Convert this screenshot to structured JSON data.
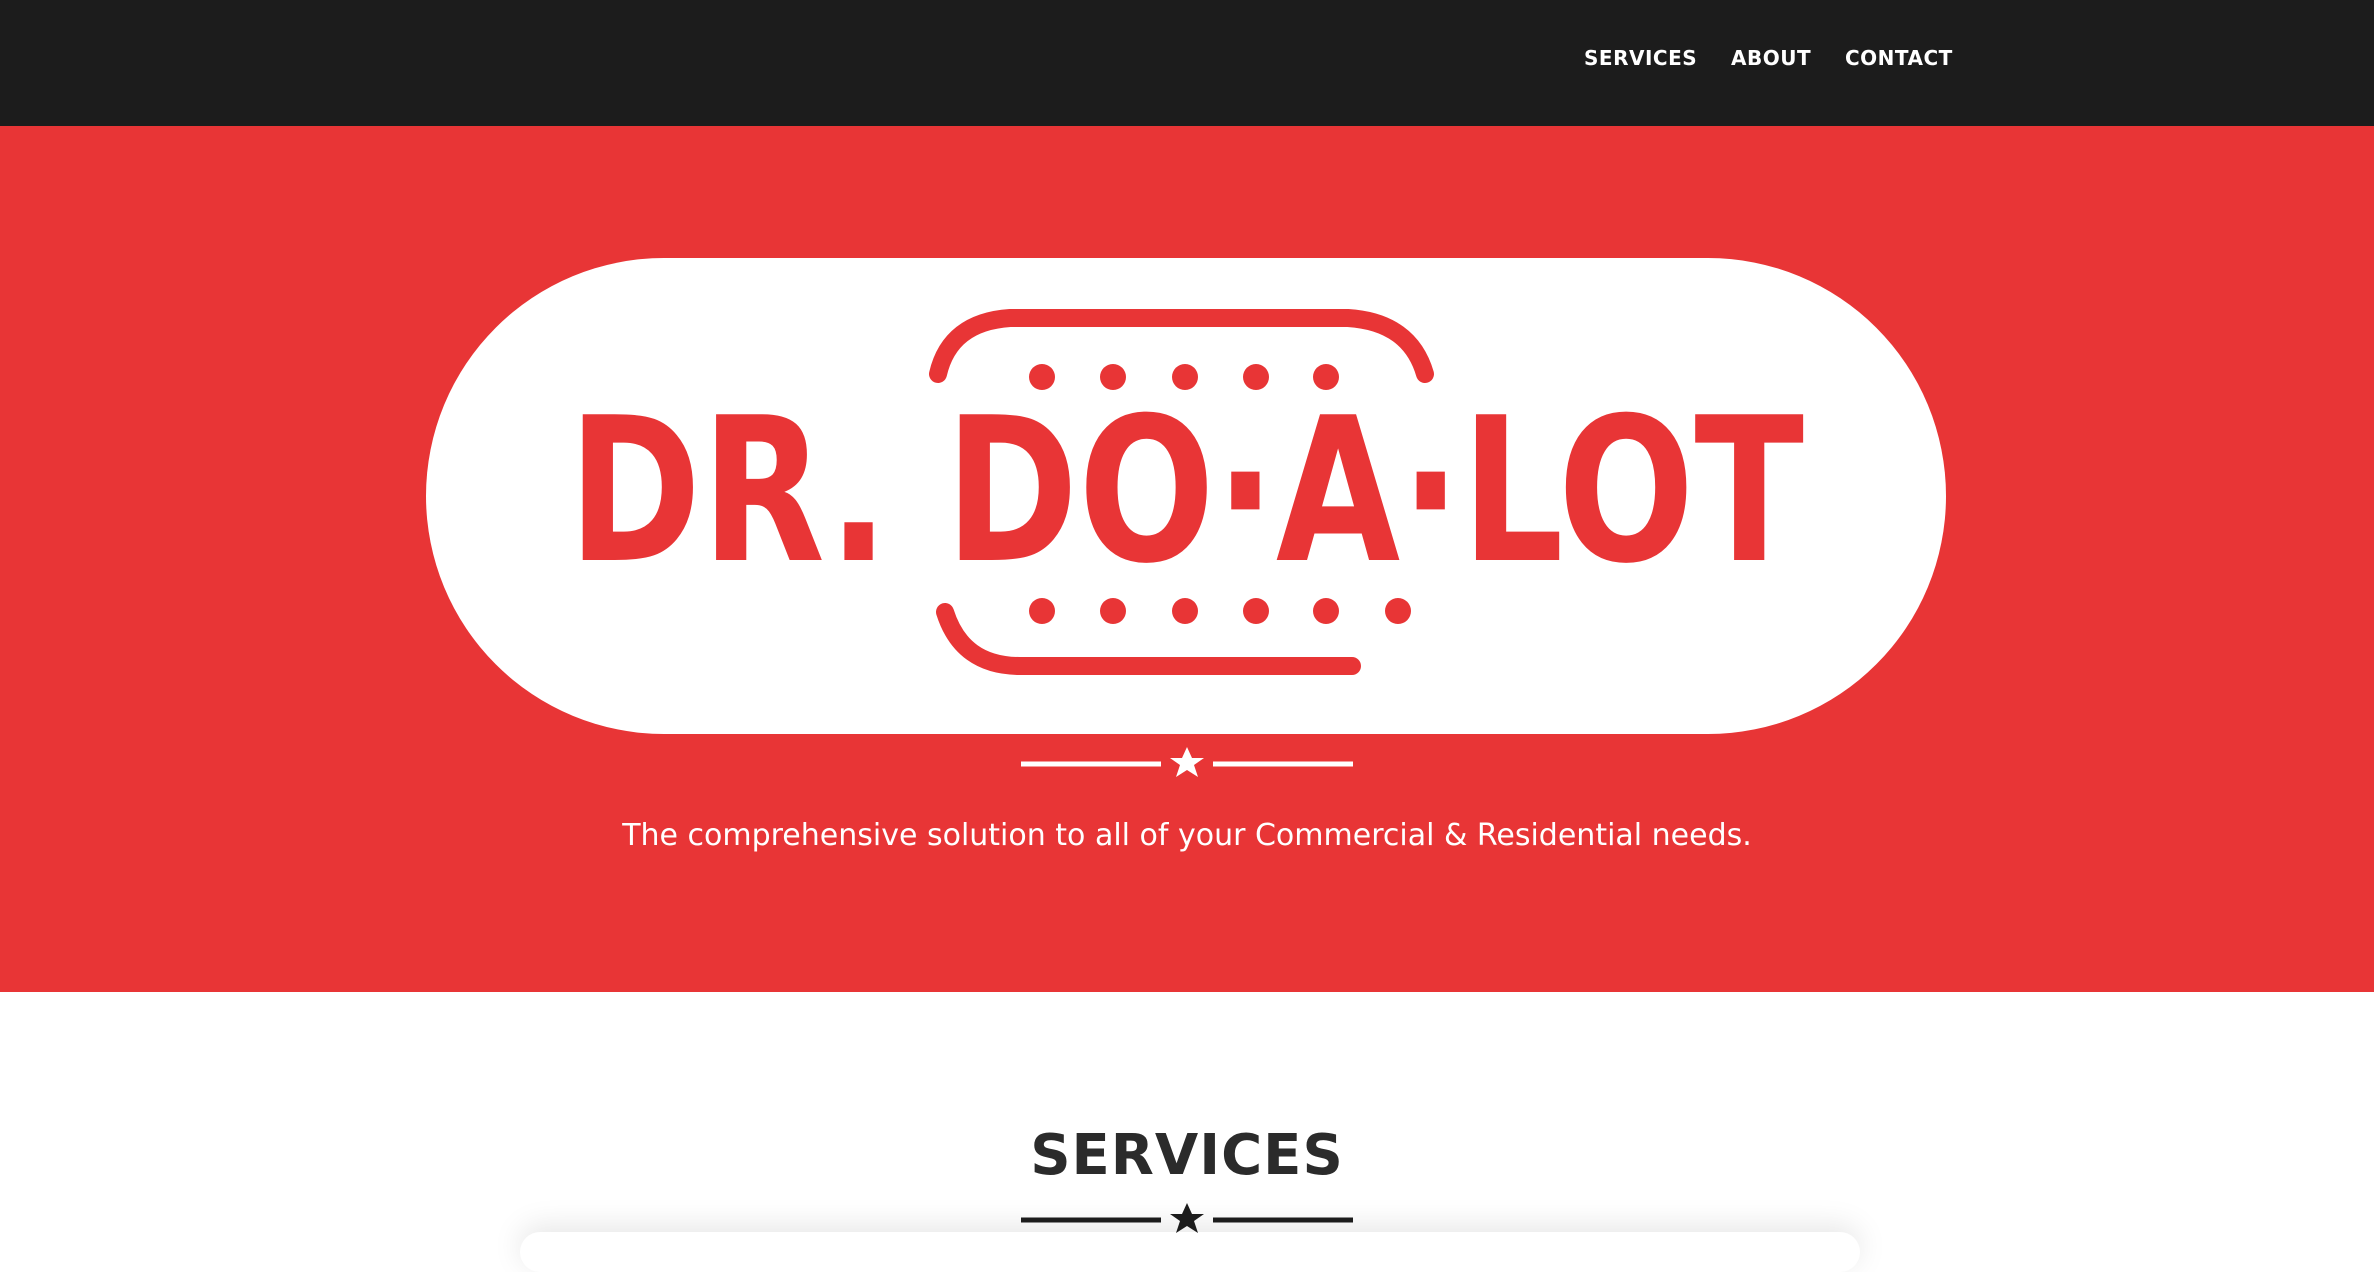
{
  "nav": {
    "links": [
      {
        "label": "SERVICES"
      },
      {
        "label": "ABOUT"
      },
      {
        "label": "CONTACT"
      }
    ]
  },
  "hero": {
    "logo_text": "DR. DO·A·LOT",
    "tagline": "The comprehensive solution to all of your Commercial & Residential needs."
  },
  "services": {
    "title": "SERVICES"
  },
  "colors": {
    "nav_bg": "#1c1c1c",
    "brand_red": "#e83536",
    "white": "#ffffff",
    "dark_text": "#2b2b2b"
  },
  "icons": {
    "hero_divider": "star-icon",
    "services_divider": "star-icon"
  }
}
